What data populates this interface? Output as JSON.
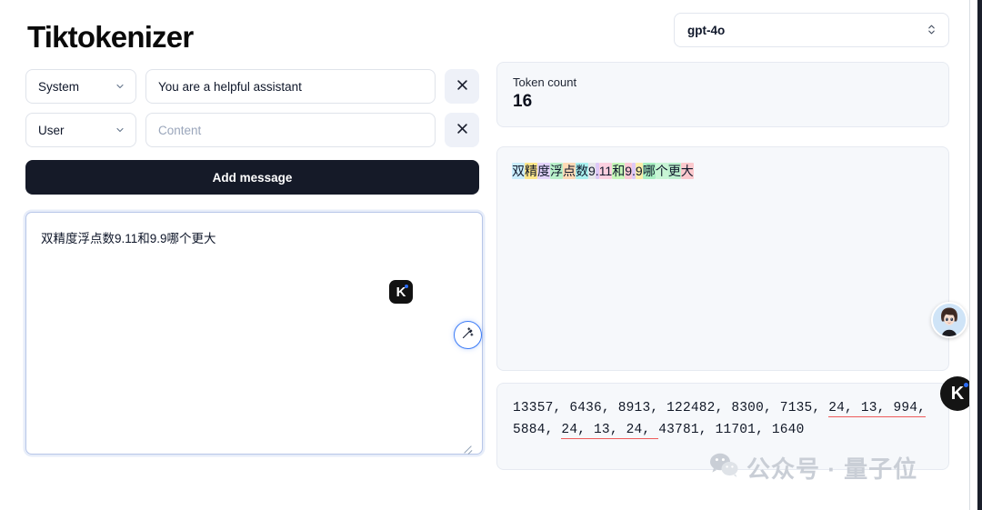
{
  "app": {
    "title": "Tiktokenizer"
  },
  "messages": [
    {
      "role_label": "System",
      "content_value": "You are a helpful assistant",
      "content_placeholder": "Content",
      "close_label": "×"
    },
    {
      "role_label": "User",
      "content_value": "",
      "content_placeholder": "Content",
      "close_label": "×"
    }
  ],
  "add_message_label": "Add message",
  "editor": {
    "value": "双精度浮点数9.11和9.9哪个更大",
    "k_badge_label": "K",
    "wand_icon": "magic-wand-icon"
  },
  "model_select": {
    "value": "gpt-4o",
    "icon": "chevron-up-down-icon"
  },
  "token_count": {
    "label": "Token count",
    "value": "16"
  },
  "tokenized": [
    {
      "text": "双",
      "color": "#c9ecfb"
    },
    {
      "text": "精",
      "color": "#fde68a"
    },
    {
      "text": "度",
      "color": "#e4d4fb"
    },
    {
      "text": "浮",
      "color": "#b8f0c9"
    },
    {
      "text": "点",
      "color": "#fdd9b5"
    },
    {
      "text": "数",
      "color": "#a9f0ef"
    },
    {
      "text": "9",
      "color": "#e6e6ea"
    },
    {
      "text": ".",
      "color": "#ddc9f7"
    },
    {
      "text": "11",
      "color": "#fbd0e0"
    },
    {
      "text": "和",
      "color": "#c6f7b9"
    },
    {
      "text": "9",
      "color": "#fbc9d4"
    },
    {
      "text": ".",
      "color": "#ddc9f7"
    },
    {
      "text": "9",
      "color": "#fdeeab"
    },
    {
      "text": "哪",
      "color": "#a9efc2"
    },
    {
      "text": "个",
      "color": "#c8f5d5"
    },
    {
      "text": "更",
      "color": "#bdf0cf"
    },
    {
      "text": "大",
      "color": "#fbc9cd"
    }
  ],
  "token_ids": [
    {
      "value": "13357, ",
      "underline": false
    },
    {
      "value": "6436, ",
      "underline": false
    },
    {
      "value": "8913, ",
      "underline": false
    },
    {
      "value": "122482, ",
      "underline": false
    },
    {
      "value": "8300, ",
      "underline": false
    },
    {
      "value": "7135, ",
      "underline": false
    },
    {
      "value": "24, 13, ",
      "underline": true
    },
    {
      "value": "994, ",
      "underline": true
    },
    {
      "value": "5884, ",
      "underline": false
    },
    {
      "value": "24, 13, 24, ",
      "underline": true
    },
    {
      "value": "43781, ",
      "underline": false
    },
    {
      "value": "11701, ",
      "underline": false
    },
    {
      "value": "1640",
      "underline": false
    }
  ],
  "floating": {
    "avatar_name": "user-avatar",
    "k_badge_label": "K"
  },
  "watermark": {
    "text": "公众号 · 量子位"
  },
  "colors": {
    "accent_dark": "#151a28",
    "focus_blue": "#3b7bf6",
    "underline_red": "#ee5a5a",
    "card_bg": "#f6f8fb"
  }
}
